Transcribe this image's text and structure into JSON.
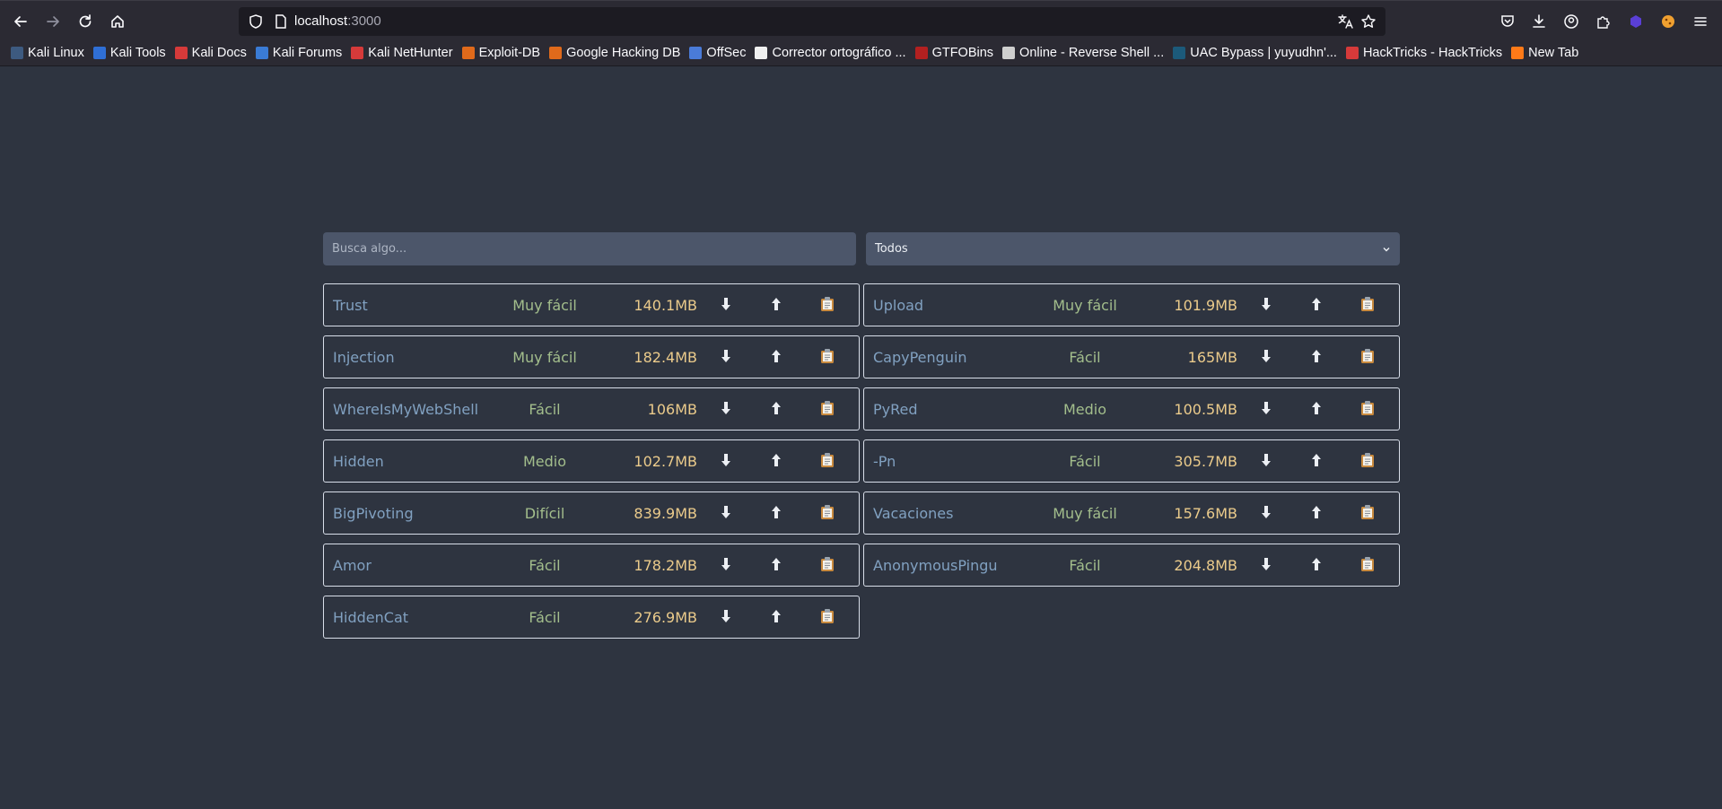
{
  "browser": {
    "url_host": "localhost",
    "url_port": ":3000",
    "bookmarks": [
      {
        "label": "Kali Linux",
        "color": "#3d5a80"
      },
      {
        "label": "Kali Tools",
        "color": "#2f6fd6"
      },
      {
        "label": "Kali Docs",
        "color": "#d63a3a"
      },
      {
        "label": "Kali Forums",
        "color": "#3a7bd5"
      },
      {
        "label": "Kali NetHunter",
        "color": "#d63a3a"
      },
      {
        "label": "Exploit-DB",
        "color": "#e06a1b"
      },
      {
        "label": "Google Hacking DB",
        "color": "#e06a1b"
      },
      {
        "label": "OffSec",
        "color": "#4a7bd8"
      },
      {
        "label": "Corrector ortográfico ...",
        "color": "#f0f0f0"
      },
      {
        "label": "GTFOBins",
        "color": "#b32020"
      },
      {
        "label": "Online - Reverse Shell ...",
        "color": "#cfcfcf"
      },
      {
        "label": "UAC Bypass | yuyudhn'...",
        "color": "#1c5a7a"
      },
      {
        "label": "HackTricks - HackTricks",
        "color": "#d63a3a"
      },
      {
        "label": "New Tab",
        "color": "#ff7a18"
      }
    ]
  },
  "controls": {
    "search_placeholder": "Busca algo...",
    "filter_selected": "Todos"
  },
  "machines": [
    {
      "name": "Trust",
      "difficulty": "Muy fácil",
      "size": "140.1MB"
    },
    {
      "name": "Upload",
      "difficulty": "Muy fácil",
      "size": "101.9MB"
    },
    {
      "name": "Injection",
      "difficulty": "Muy fácil",
      "size": "182.4MB"
    },
    {
      "name": "CapyPenguin",
      "difficulty": "Fácil",
      "size": "165MB"
    },
    {
      "name": "WhereIsMyWebShell",
      "difficulty": "Fácil",
      "size": "106MB"
    },
    {
      "name": "PyRed",
      "difficulty": "Medio",
      "size": "100.5MB"
    },
    {
      "name": "Hidden",
      "difficulty": "Medio",
      "size": "102.7MB"
    },
    {
      "name": "-Pn",
      "difficulty": "Fácil",
      "size": "305.7MB"
    },
    {
      "name": "BigPivoting",
      "difficulty": "Difícil",
      "size": "839.9MB"
    },
    {
      "name": "Vacaciones",
      "difficulty": "Muy fácil",
      "size": "157.6MB"
    },
    {
      "name": "Amor",
      "difficulty": "Fácil",
      "size": "178.2MB"
    },
    {
      "name": "AnonymousPingu",
      "difficulty": "Fácil",
      "size": "204.8MB"
    },
    {
      "name": "HiddenCat",
      "difficulty": "Fácil",
      "size": "276.9MB"
    }
  ],
  "icons": {
    "download": "download-arrow-icon",
    "upload": "upload-arrow-icon",
    "copy": "clipboard-icon"
  },
  "colors": {
    "background": "#2e3440",
    "name": "#81a1c1",
    "difficulty": "#a3be8c",
    "size": "#ebcb8b",
    "border": "#d8dee9"
  }
}
